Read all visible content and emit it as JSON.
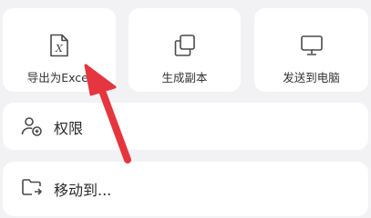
{
  "actions": [
    {
      "label": "导出为Excel",
      "icon": "excel-file-icon"
    },
    {
      "label": "生成副本",
      "icon": "copy-icon"
    },
    {
      "label": "发送到电脑",
      "icon": "monitor-icon"
    }
  ],
  "rows": [
    {
      "label": "权限",
      "icon": "user-add-icon"
    },
    {
      "label": "移动到...",
      "icon": "folder-move-icon"
    }
  ],
  "annotation": {
    "color": "#e5363f"
  }
}
